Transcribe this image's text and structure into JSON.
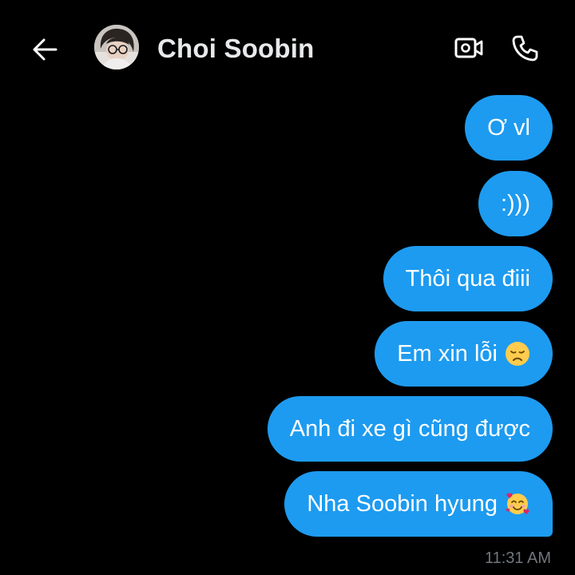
{
  "header": {
    "contact_name": "Choi Soobin",
    "back_icon": "back-arrow-icon",
    "video_icon": "video-camera-icon",
    "call_icon": "phone-icon"
  },
  "messages": [
    {
      "text": "Ơ vl",
      "emoji": ""
    },
    {
      "text": ":)))",
      "emoji": ""
    },
    {
      "text": "Thôi qua điii",
      "emoji": ""
    },
    {
      "text": "Em xin lỗi",
      "emoji": "disappointed-face-emoji"
    },
    {
      "text": "Anh đi xe gì cũng được",
      "emoji": ""
    },
    {
      "text": "Nha Soobin hyung",
      "emoji": "smiling-face-with-hearts-emoji"
    }
  ],
  "timestamp": "11:31 AM",
  "colors": {
    "background": "#000000",
    "bubble": "#1d9bf0",
    "header_text": "#e7e9ea",
    "timestamp": "#71767b"
  }
}
